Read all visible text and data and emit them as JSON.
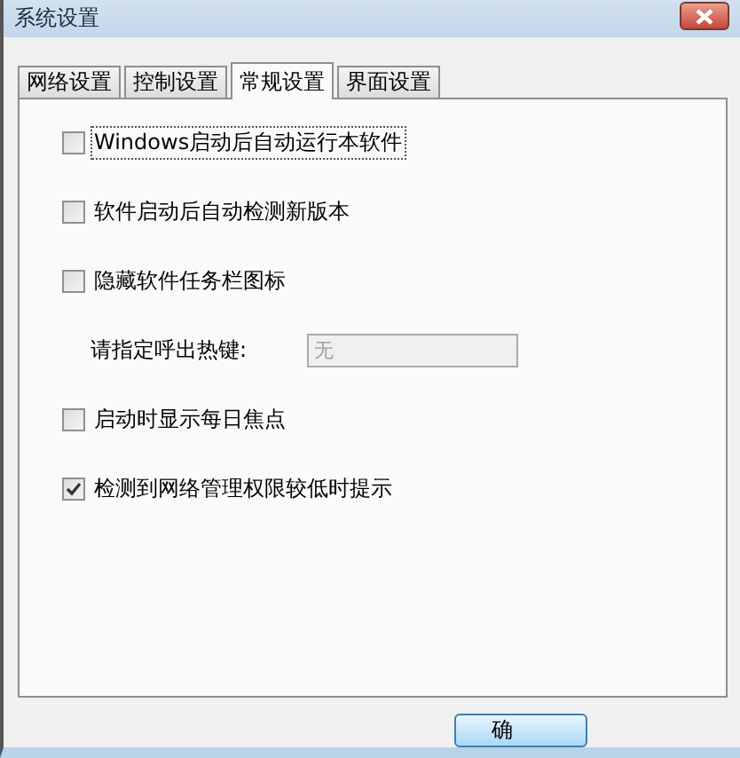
{
  "window": {
    "title": "系统设置"
  },
  "tabs": [
    {
      "label": "网络设置",
      "selected": false
    },
    {
      "label": "控制设置",
      "selected": false
    },
    {
      "label": "常规设置",
      "selected": true
    },
    {
      "label": "界面设置",
      "selected": false
    }
  ],
  "options": [
    {
      "kind": "checkbox",
      "label": "Windows启动后自动运行本软件",
      "checked": false,
      "focused": true
    },
    {
      "kind": "checkbox",
      "label": "软件启动后自动检测新版本",
      "checked": false,
      "focused": false
    },
    {
      "kind": "checkbox",
      "label": "隐藏软件任务栏图标",
      "checked": false,
      "focused": false
    },
    {
      "kind": "hotkey",
      "label": "请指定呼出热键:",
      "value": "无",
      "disabled": true
    },
    {
      "kind": "checkbox",
      "label": "启动时显示每日焦点",
      "checked": false,
      "focused": false
    },
    {
      "kind": "checkbox",
      "label": "检测到网络管理权限较低时提示",
      "checked": true,
      "focused": false
    }
  ],
  "buttons": [
    "确"
  ]
}
